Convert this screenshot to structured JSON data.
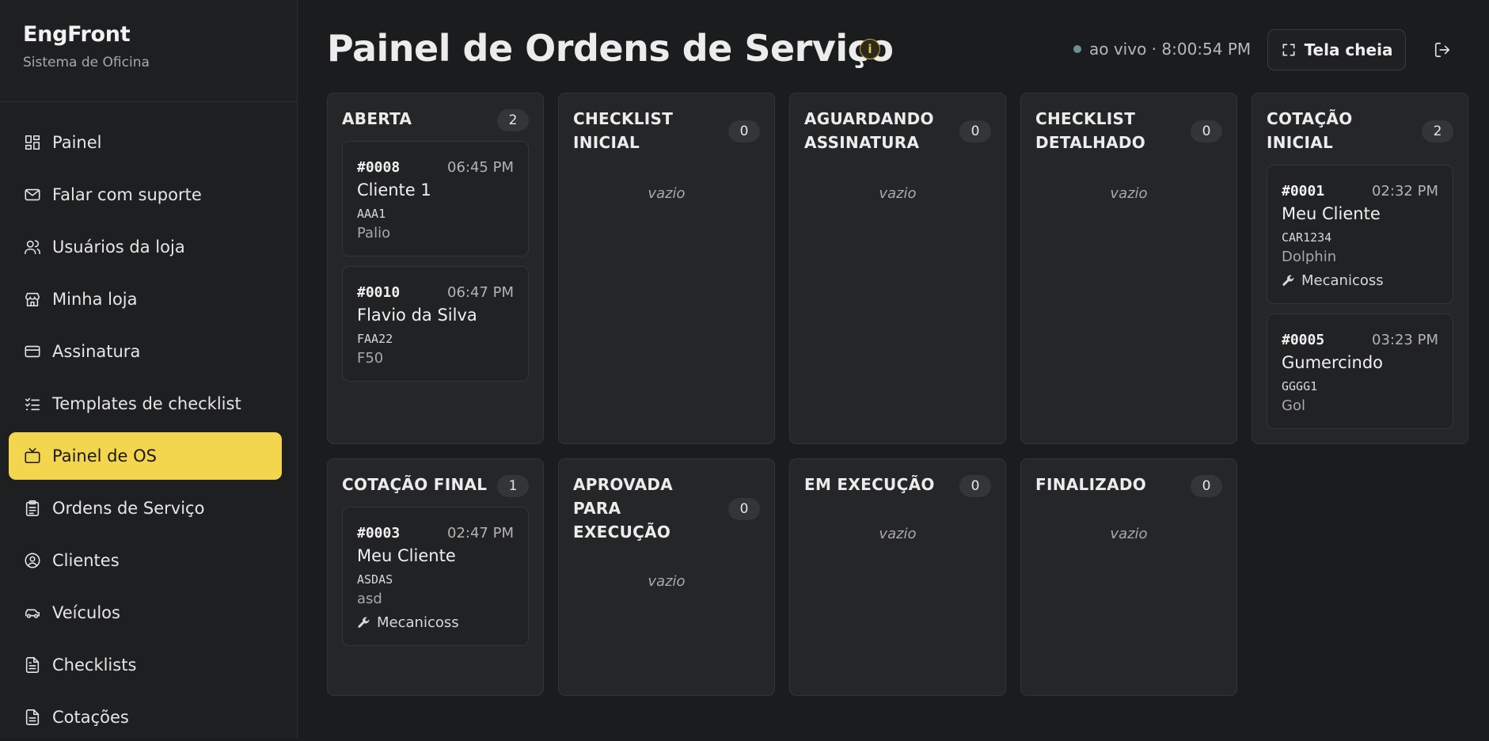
{
  "brand": {
    "title": "EngFront",
    "subtitle": "Sistema de Oficina"
  },
  "nav": [
    {
      "label": "Painel",
      "icon": "dashboard-icon"
    },
    {
      "label": "Falar com suporte",
      "icon": "mail-icon"
    },
    {
      "label": "Usuários da loja",
      "icon": "users-icon"
    },
    {
      "label": "Minha loja",
      "icon": "store-icon"
    },
    {
      "label": "Assinatura",
      "icon": "credit-card-icon"
    },
    {
      "label": "Templates de checklist",
      "icon": "list-checks-icon"
    },
    {
      "label": "Painel de OS",
      "icon": "tv-icon",
      "active": true
    },
    {
      "label": "Ordens de Serviço",
      "icon": "clipboard-icon"
    },
    {
      "label": "Clientes",
      "icon": "user-circle-icon"
    },
    {
      "label": "Veículos",
      "icon": "car-icon"
    },
    {
      "label": "Checklists",
      "icon": "file-text-icon"
    },
    {
      "label": "Cotações",
      "icon": "receipt-icon"
    }
  ],
  "header": {
    "title": "Painel de Ordens de Serviço",
    "info": "i",
    "live_text": "ao vivo · 8:00:54 PM",
    "fullscreen_label": "Tela cheia"
  },
  "empty_text": "vazio",
  "columns": [
    {
      "title": "ABERTA",
      "count": "2",
      "cards": [
        {
          "num": "#0008",
          "time": "06:45 PM",
          "name": "Cliente 1",
          "plate": "AAA1",
          "model": "Palio"
        },
        {
          "num": "#0010",
          "time": "06:47 PM",
          "name": "Flavio da Silva",
          "plate": "FAA22",
          "model": "F50"
        }
      ]
    },
    {
      "title": "CHECKLIST INICIAL",
      "count": "0",
      "cards": []
    },
    {
      "title": "AGUARDANDO ASSINATURA",
      "count": "0",
      "cards": []
    },
    {
      "title": "CHECKLIST DETALHADO",
      "count": "0",
      "cards": []
    },
    {
      "title": "COTAÇÃO INICIAL",
      "count": "2",
      "cards": [
        {
          "num": "#0001",
          "time": "02:32 PM",
          "name": "Meu Cliente",
          "plate": "CAR1234",
          "model": "Dolphin",
          "mechanic": "Mecanicoss"
        },
        {
          "num": "#0005",
          "time": "03:23 PM",
          "name": "Gumercindo",
          "plate": "GGGG1",
          "model": "Gol"
        }
      ]
    },
    {
      "title": "COTAÇÃO FINAL",
      "count": "1",
      "cards": [
        {
          "num": "#0003",
          "time": "02:47 PM",
          "name": "Meu Cliente",
          "plate": "ASDAS",
          "model": "asd",
          "mechanic": "Mecanicoss"
        }
      ]
    },
    {
      "title": "APROVADA PARA EXECUÇÃO",
      "count": "0",
      "cards": []
    },
    {
      "title": "EM EXECUÇÃO",
      "count": "0",
      "cards": []
    },
    {
      "title": "FINALIZADO",
      "count": "0",
      "cards": []
    }
  ],
  "colors": {
    "accent": "#f3d54e",
    "background": "#1b1c1e",
    "panel": "#252628"
  }
}
